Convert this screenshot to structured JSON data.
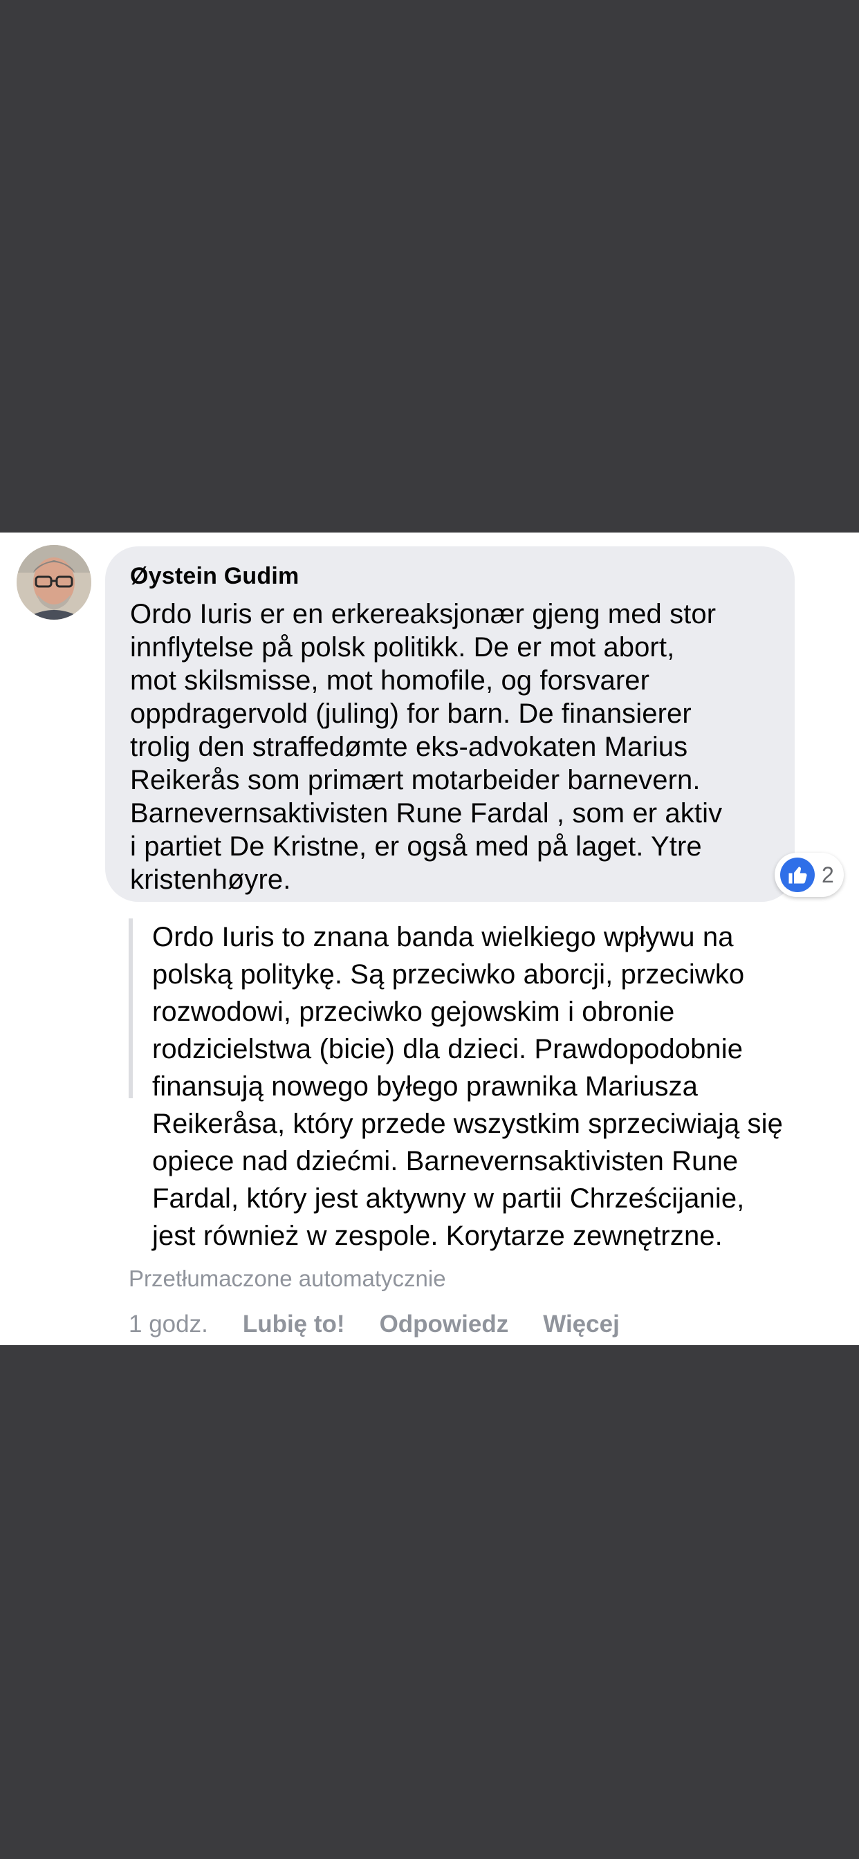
{
  "comment": {
    "author": "Øystein Gudim",
    "avatar_icon": "user-avatar-photo",
    "text_lines": [
      "Ordo Iuris er en erkereaksjonær gjeng med stor",
      "innflytelse på polsk politikk. De er mot abort,",
      "mot skilsmisse, mot homofile, og forsvarer",
      "oppdragervold (juling) for barn. De finansierer",
      "trolig den straffedømte eks-advokaten Marius",
      "Reikerås som primært motarbeider barnevern.",
      "Barnevernsaktivisten Rune Fardal , som er aktiv",
      "i partiet De Kristne, er også med på laget. Ytre",
      "kristenhøyre."
    ],
    "reactions": {
      "icon": "like-thumbs-up-icon",
      "count": "2",
      "color": "#2f6fe8"
    },
    "translation_lines": [
      "Ordo Iuris to znana banda wielkiego wpływu na",
      "polską politykę. Są przeciwko aborcji, przeciwko",
      "rozwodowi, przeciwko gejowskim i obronie",
      "rodzicielstwa (bicie) dla dzieci. Prawdopodobnie",
      "finansują nowego byłego prawnika Mariusza",
      "Reikeråsa, który przede wszystkim sprzeciwiają się",
      "opiece nad dziećmi. Barnevernsaktivisten Rune",
      "Fardal, który jest aktywny w partii Chrześcijanie,",
      "jest również w zespole. Korytarze zewnętrzne."
    ],
    "translated_note": "Przetłumaczone automatycznie",
    "actions": {
      "time": "1 godz.",
      "like": "Lubię to!",
      "reply": "Odpowiedz",
      "more": "Więcej"
    }
  }
}
